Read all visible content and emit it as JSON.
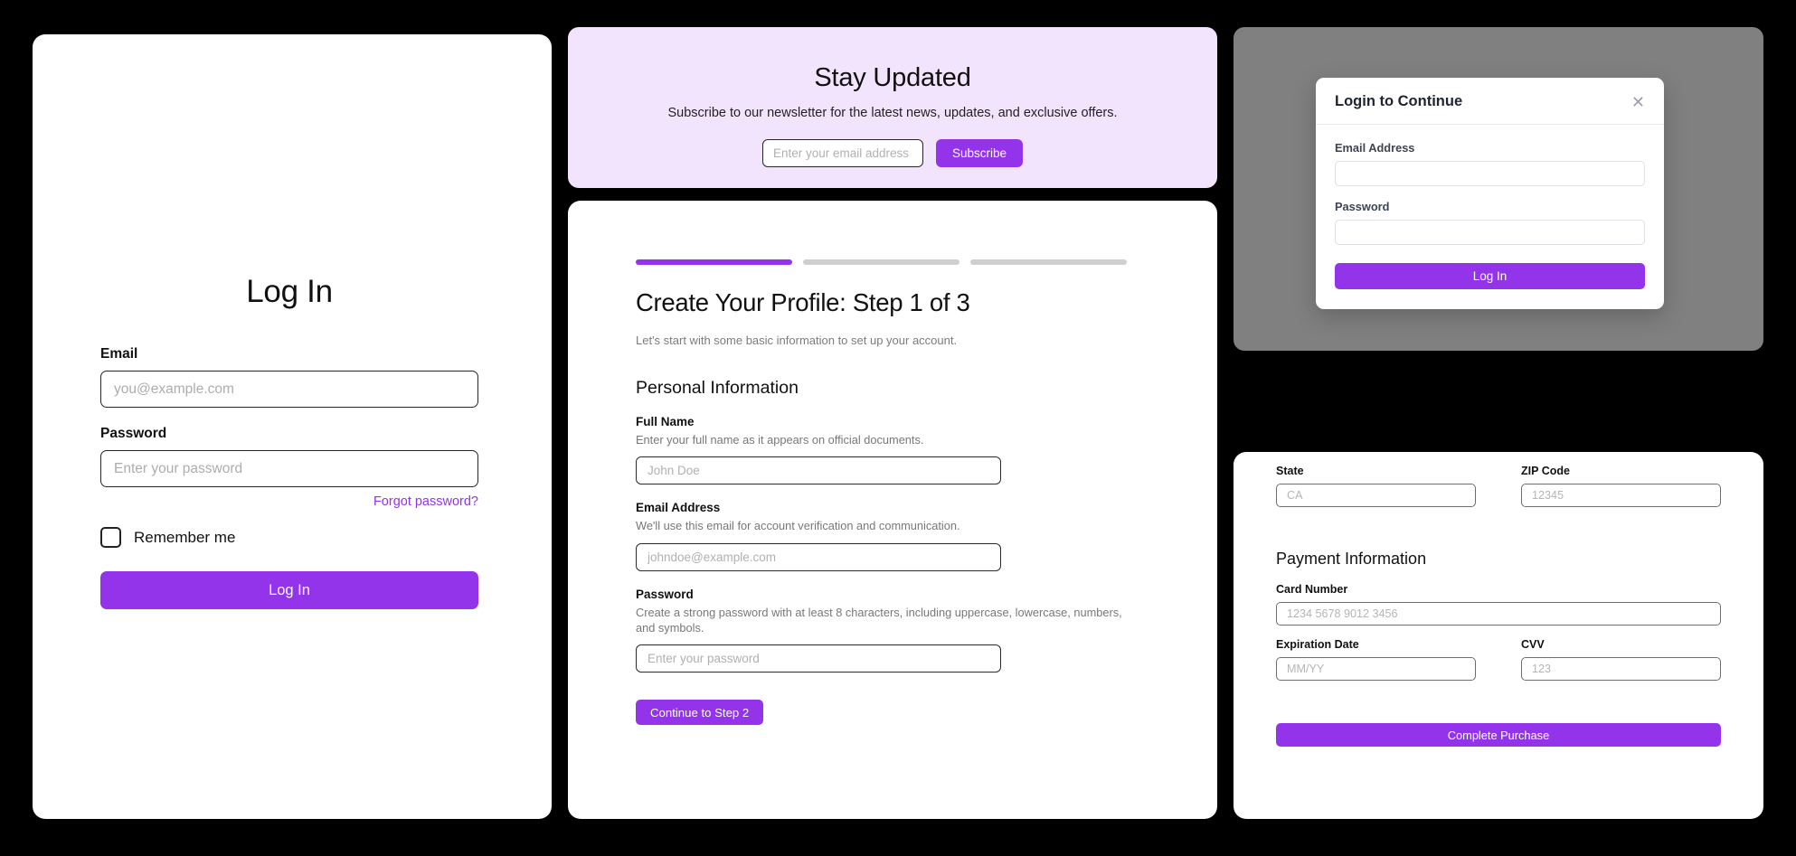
{
  "login_panel": {
    "title": "Log In",
    "email_label": "Email",
    "email_placeholder": "you@example.com",
    "email_value": "",
    "password_label": "Password",
    "password_placeholder": "Enter your password",
    "password_value": "",
    "forgot_link": "Forgot password?",
    "remember_label": "Remember me",
    "submit_label": "Log In"
  },
  "newsletter_panel": {
    "title": "Stay Updated",
    "subtitle": "Subscribe to our newsletter for the latest news, updates, and exclusive offers.",
    "email_placeholder": "Enter your email address",
    "email_value": "",
    "subscribe_label": "Subscribe",
    "background_color": "#f3e4fd"
  },
  "profile_panel": {
    "progress": {
      "total_steps": 3,
      "current_step": 1
    },
    "title": "Create Your Profile: Step 1 of 3",
    "subtitle": "Let's start with some basic information to set up your account.",
    "section_heading": "Personal Information",
    "fields": [
      {
        "label": "Full Name",
        "hint": "Enter your full name as it appears on official documents.",
        "placeholder": "John Doe",
        "value": ""
      },
      {
        "label": "Email Address",
        "hint": "We'll use this email for account verification and communication.",
        "placeholder": "johndoe@example.com",
        "value": ""
      },
      {
        "label": "Password",
        "hint": "Create a strong password with at least 8 characters, including uppercase, lowercase, numbers, and symbols.",
        "placeholder": "Enter your password",
        "value": ""
      }
    ],
    "cta_label": "Continue to Step 2"
  },
  "modal_panel": {
    "overlay_color": "#808080",
    "title": "Login to Continue",
    "close_icon": "close-icon",
    "email_label": "Email Address",
    "email_value": "",
    "password_label": "Password",
    "password_value": "",
    "submit_label": "Log In"
  },
  "checkout_panel": {
    "state_label": "State",
    "state_placeholder": "CA",
    "state_value": "",
    "zip_label": "ZIP Code",
    "zip_placeholder": "12345",
    "zip_value": "",
    "payment_heading": "Payment Information",
    "card_label": "Card Number",
    "card_placeholder": "1234 5678 9012 3456",
    "card_value": "",
    "expiry_label": "Expiration Date",
    "expiry_placeholder": "MM/YY",
    "expiry_value": "",
    "cvv_label": "CVV",
    "cvv_placeholder": "123",
    "cvv_value": "",
    "submit_label": "Complete Purchase"
  },
  "theme": {
    "accent": "#9333ea",
    "page_background": "#000000",
    "panel_background": "#ffffff"
  }
}
